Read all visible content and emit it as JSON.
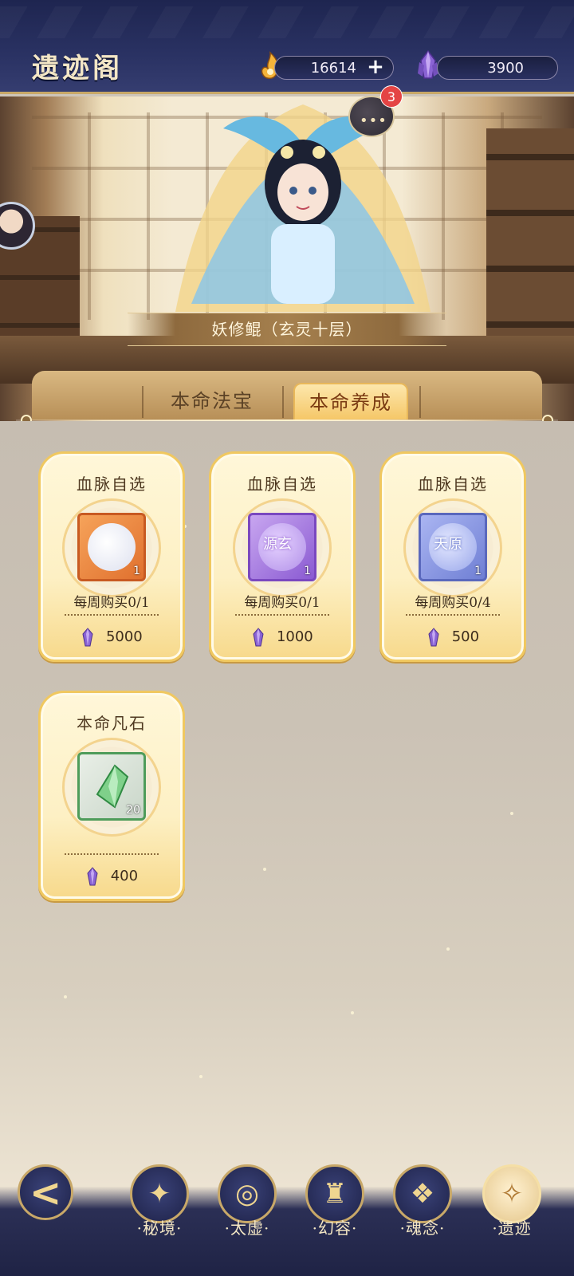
{
  "header": {
    "title": "遗迹阁",
    "spirit_amount": "16614",
    "crystal_amount": "3900",
    "plus_label": "+"
  },
  "hero": {
    "character_name": "妖修鲲（玄灵十层）",
    "chat_badge_count": "3",
    "chat_dots": "•••"
  },
  "tabs": [
    {
      "label": "本命法宝",
      "active": false
    },
    {
      "label": "本命养成",
      "active": true
    }
  ],
  "shop": {
    "items": [
      {
        "title": "血脉自选",
        "item_label": "",
        "qty": "1",
        "limit": "每周购买0/1",
        "price": "5000",
        "rarity": "orange"
      },
      {
        "title": "血脉自选",
        "item_label": "源玄",
        "qty": "1",
        "limit": "每周购买0/1",
        "price": "1000",
        "rarity": "purple"
      },
      {
        "title": "血脉自选",
        "item_label": "天原",
        "qty": "1",
        "limit": "每周购买0/4",
        "price": "500",
        "rarity": "blue"
      },
      {
        "title": "本命凡石",
        "item_label": "",
        "qty": "20",
        "limit": "",
        "price": "400",
        "rarity": "green"
      }
    ]
  },
  "bottom_nav": {
    "back_icon": "<",
    "items": [
      {
        "label": "·秘境·",
        "glyph": "✦",
        "icon": "secret-realm-icon"
      },
      {
        "label": "·太虚·",
        "glyph": "◎",
        "icon": "void-icon"
      },
      {
        "label": "·幻容·",
        "glyph": "♜",
        "icon": "appearance-icon"
      },
      {
        "label": "·魂念·",
        "glyph": "❖",
        "icon": "soul-icon"
      },
      {
        "label": "·遗迹",
        "glyph": "✧",
        "icon": "ruins-icon",
        "active": true
      }
    ]
  },
  "colors": {
    "header_bg": "#2a3263",
    "accent_gold": "#c8a868",
    "card_border": "#f0c860",
    "badge_red": "#e44444"
  }
}
